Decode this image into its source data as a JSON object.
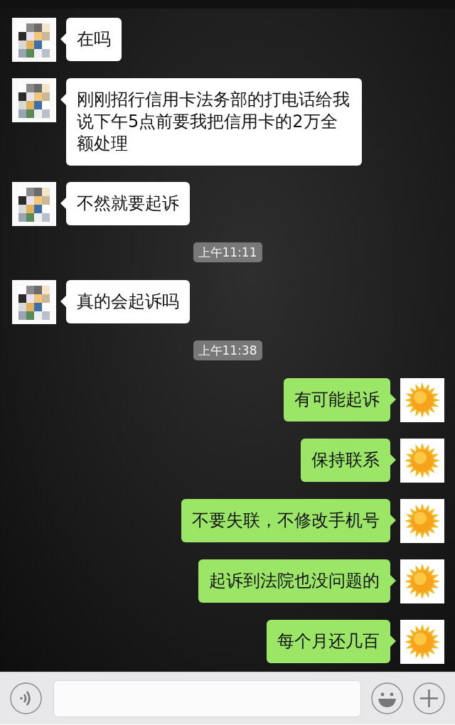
{
  "messages": [
    {
      "kind": "incoming",
      "text": "在吗"
    },
    {
      "kind": "incoming",
      "text": "刚刚招行信用卡法务部的打电话给我说下午5点前要我把信用卡的2万全额处理"
    },
    {
      "kind": "incoming",
      "text": "不然就要起诉"
    },
    {
      "kind": "time",
      "text": "上午11:11"
    },
    {
      "kind": "incoming",
      "text": "真的会起诉吗"
    },
    {
      "kind": "time",
      "text": "上午11:38"
    },
    {
      "kind": "outgoing",
      "text": "有可能起诉"
    },
    {
      "kind": "outgoing",
      "text": "保持联系"
    },
    {
      "kind": "outgoing",
      "text": "不要失联，不修改手机号"
    },
    {
      "kind": "outgoing",
      "text": "起诉到法院也没问题的"
    },
    {
      "kind": "outgoing",
      "text": "每个月还几百"
    }
  ]
}
